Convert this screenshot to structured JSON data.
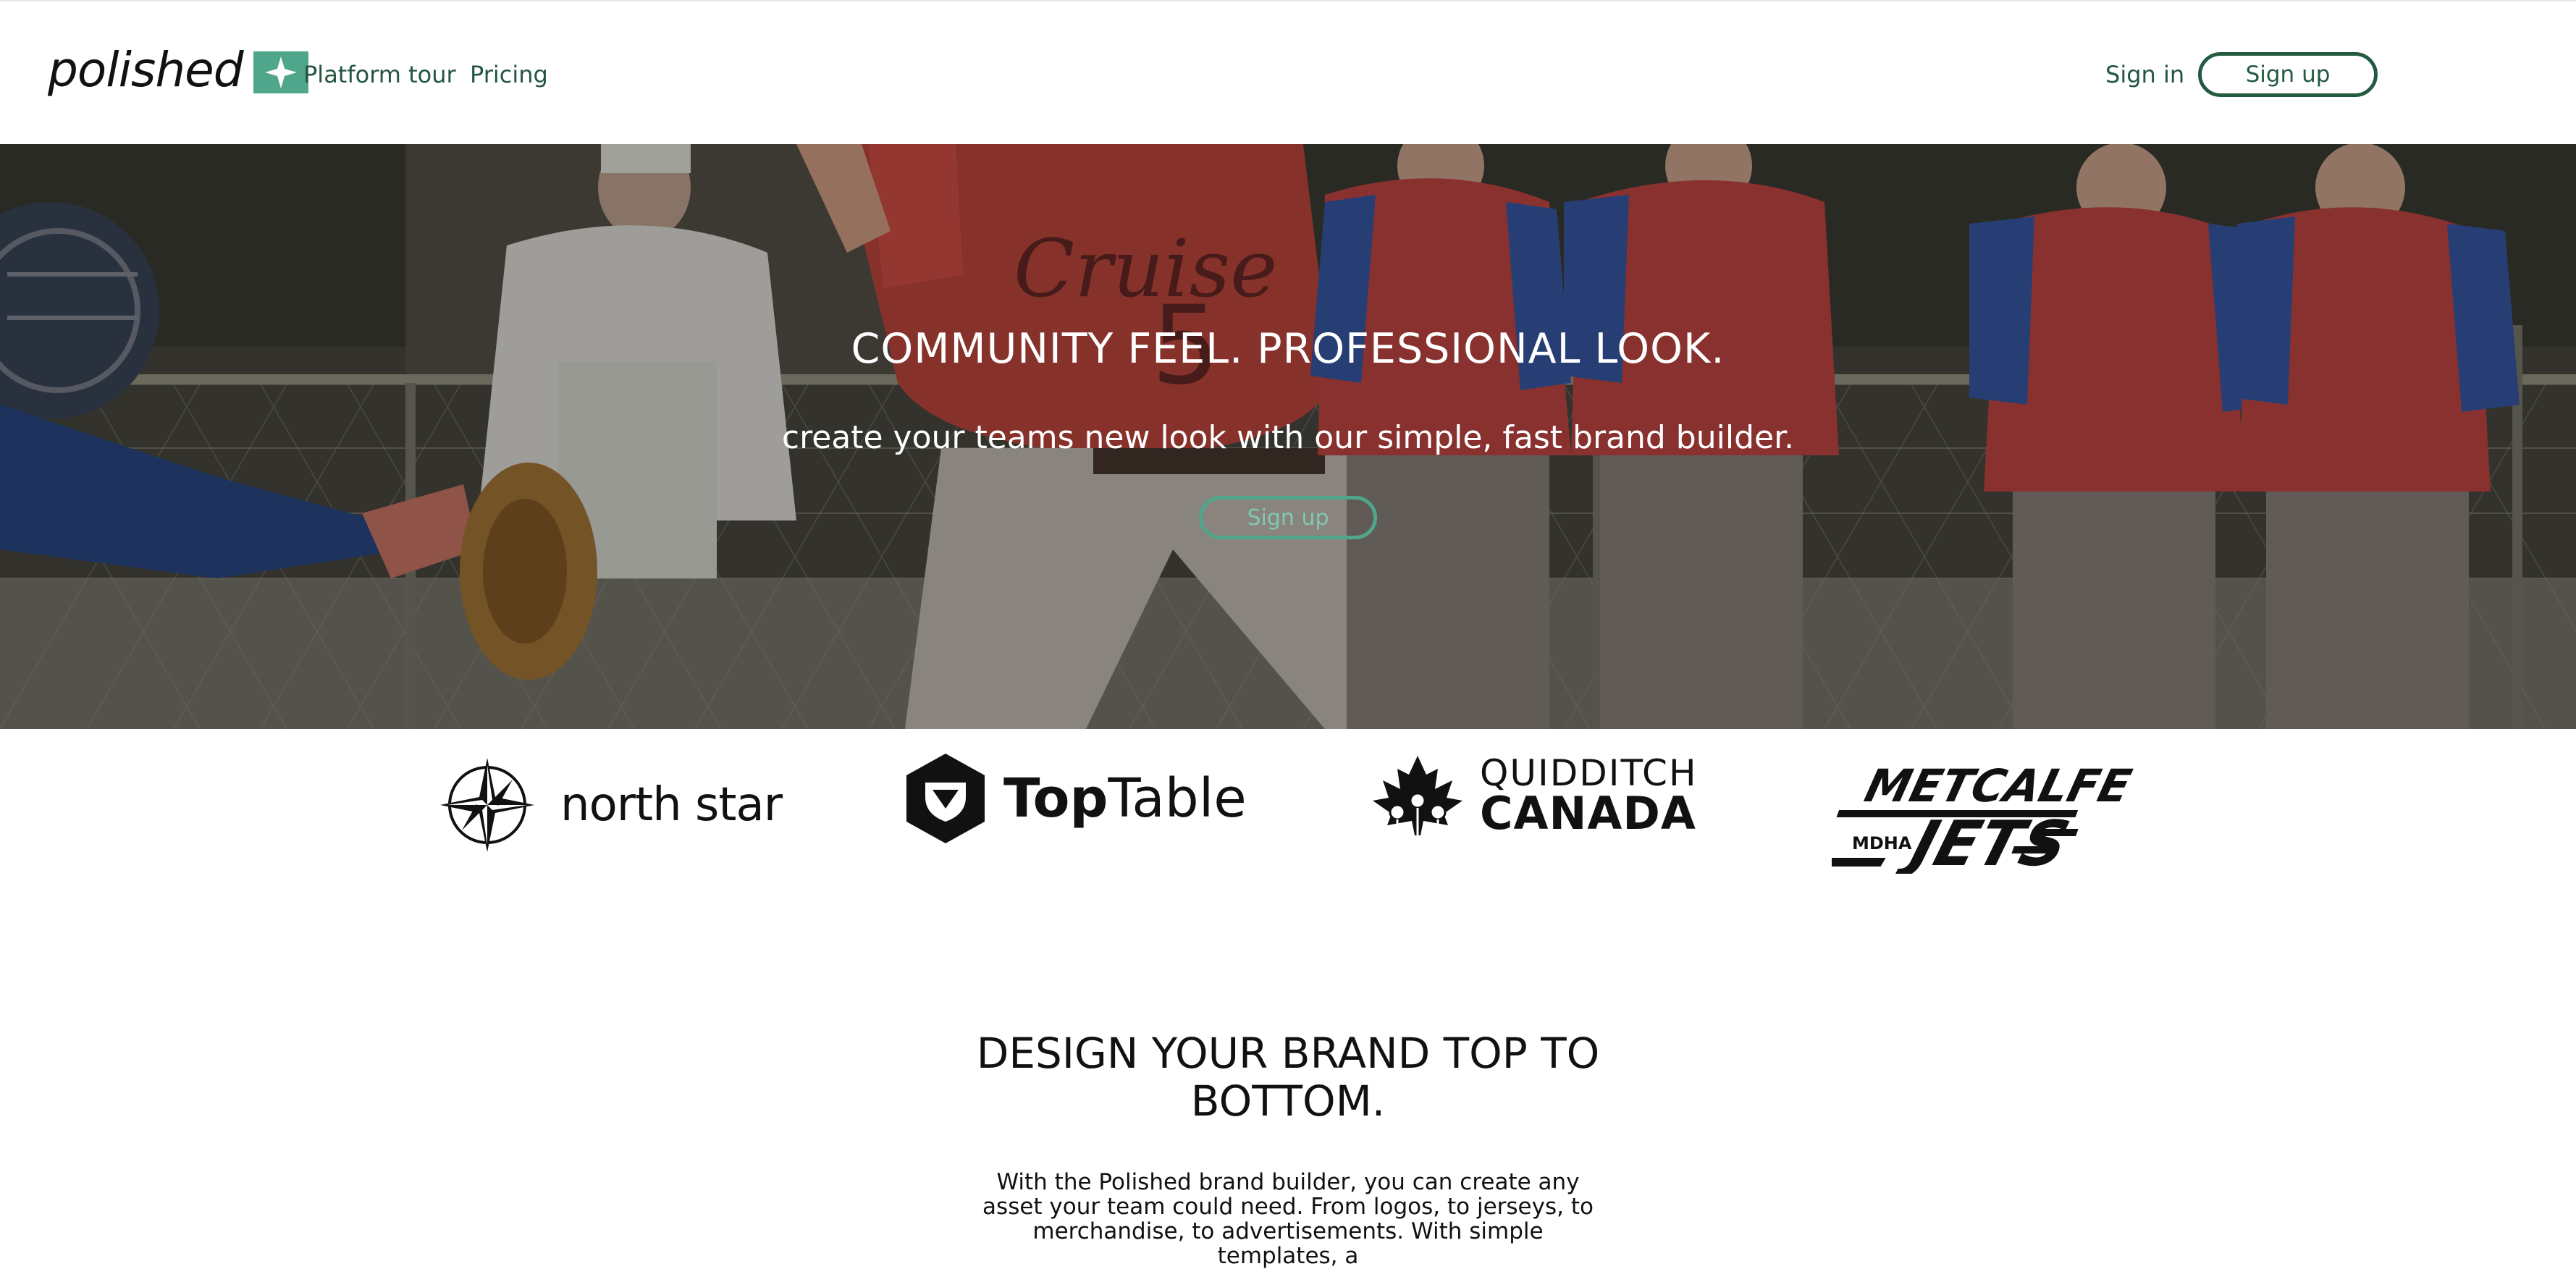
{
  "nav": {
    "logo_text": "polished",
    "logo_mark_icon": "sparkle-star-icon",
    "links": {
      "tour": "Platform tour",
      "pricing": "Pricing",
      "signin": "Sign in"
    },
    "signup_label": "Sign up"
  },
  "hero": {
    "title": "COMMUNITY FEEL. PROFESSIONAL LOOK.",
    "subtitle": "create your teams new look with our simple, fast brand builder.",
    "signup_label": "Sign up"
  },
  "clients": {
    "northstar": "north star",
    "toptable_bold": "Top",
    "toptable_regular": "Table",
    "quidditch_top": "QUIDDITCH",
    "quidditch_bottom": "CANADA",
    "metcalfe_top": "METCALFE",
    "metcalfe_small": "MDHA",
    "metcalfe_bottom": "JETS"
  },
  "design": {
    "title": "DESIGN YOUR BRAND TOP TO BOTTOM.",
    "body": "With the Polished brand builder, you can create any asset your team could need. From logos, to jerseys, to merchandise, to advertisements. With simple templates, a"
  },
  "colors": {
    "brand_green": "#4fa68b",
    "dark_green": "#235a40",
    "hero_text": "#ffffff"
  }
}
